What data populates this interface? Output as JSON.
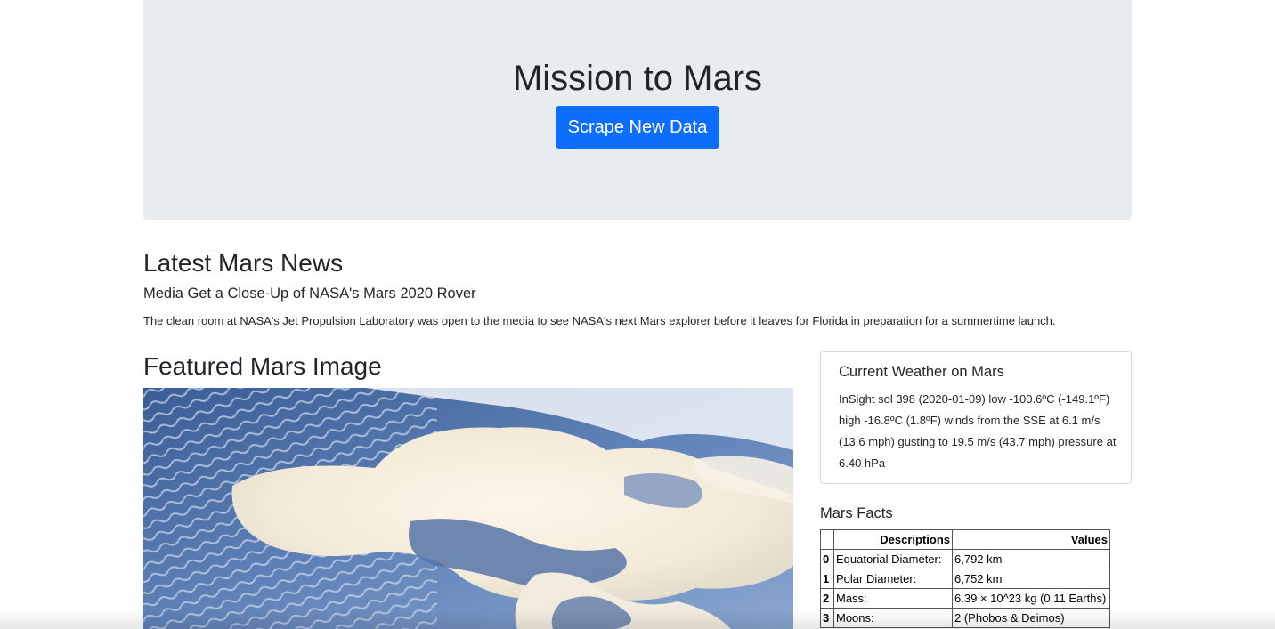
{
  "header": {
    "title": "Mission to Mars",
    "scrape_button_label": "Scrape New Data"
  },
  "news": {
    "section_heading": "Latest Mars News",
    "title": "Media Get a Close-Up of NASA's Mars 2020 Rover",
    "paragraph": "The clean room at NASA's Jet Propulsion Laboratory was open to the media to see NASA's next Mars explorer before it leaves for Florida in preparation for a summertime launch."
  },
  "featured_image": {
    "section_heading": "Featured Mars Image"
  },
  "weather": {
    "heading": "Current Weather on Mars",
    "text": "InSight sol 398 (2020-01-09) low -100.6ºC (-149.1ºF) high -16.8ºC (1.8ºF) winds from the SSE at 6.1 m/s (13.6 mph) gusting to 19.5 m/s (43.7 mph) pressure at 6.40 hPa"
  },
  "facts": {
    "heading": "Mars Facts",
    "columns": [
      "",
      "Descriptions",
      "Values"
    ],
    "rows": [
      {
        "index": "0",
        "description": "Equatorial Diameter:",
        "value": "6,792 km"
      },
      {
        "index": "1",
        "description": "Polar Diameter:",
        "value": "6,752 km"
      },
      {
        "index": "2",
        "description": "Mass:",
        "value": "6.39 × 10^23 kg (0.11 Earths)"
      },
      {
        "index": "3",
        "description": "Moons:",
        "value": "2 (Phobos & Deimos)"
      }
    ]
  },
  "colors": {
    "primary_button": "#0d6efd",
    "jumbotron_bg": "#e9ecef"
  }
}
